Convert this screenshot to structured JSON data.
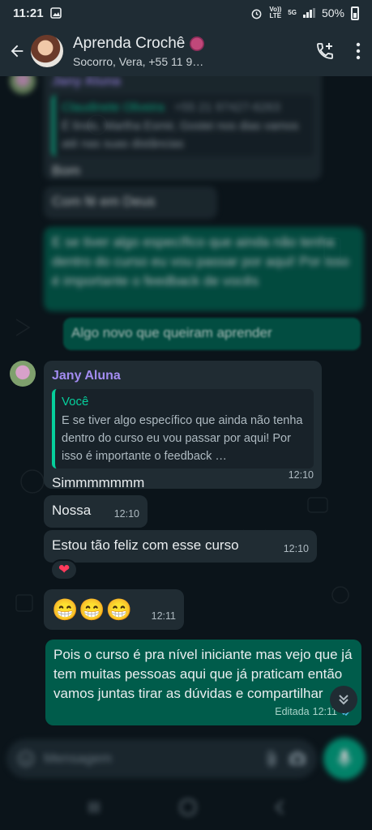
{
  "status_bar": {
    "time": "11:21",
    "network_top": "Vo))",
    "network_bottom": "LTE",
    "five_g": "5G",
    "battery": "50%"
  },
  "header": {
    "title": "Aprenda Crochê",
    "subtitle": "Socorro, Vera, +55 11 9…",
    "icons": [
      "back-arrow-icon",
      "add-call-icon",
      "more-vert-icon"
    ]
  },
  "messages_blurred": {
    "top_sender": "Jany Aluna",
    "quoted_name": "Claudinete Oliveira",
    "quoted_phone": "+55 21 97427-6263",
    "quoted_text": "É lindo, Martha Esmir, Gostei nos dias vamos até nas suas distâncias",
    "reply_text": "Bom",
    "short_msg": "Com fé em Deus",
    "out_long": "E se tiver algo específico que ainda não tenha dentro do curso eu vou passar por aqui! Por isso é importante o feedback de vocês",
    "out_short": "Algo novo que queiram aprender"
  },
  "messages": [
    {
      "sender": "Jany Aluna",
      "quote_author": "Você",
      "quote_text": "E se tiver algo específico que ainda não tenha dentro do curso eu vou passar por aqui! Por isso é importante o feedback …",
      "text": "Simmmmmmm",
      "time": "12:10"
    },
    {
      "text": "Nossa",
      "time": "12:10"
    },
    {
      "text": "Estou tão feliz com esse curso",
      "time": "12:10",
      "reaction": "❤"
    },
    {
      "text": "😁😁😁",
      "time": "12:11"
    },
    {
      "text": "Pois o curso é pra nível iniciante mas vejo que já tem muitas pessoas aqui que já praticam então vamos juntas tirar as dúvidas e compartilhar",
      "time": "12:11",
      "edited_label": "Editada"
    }
  ],
  "composer": {
    "placeholder": "Mensagem"
  },
  "colors": {
    "bg": "#0b141a",
    "incoming": "#202c33",
    "outgoing": "#005c4b",
    "accent": "#00a884",
    "sender": "#a38cf1"
  }
}
